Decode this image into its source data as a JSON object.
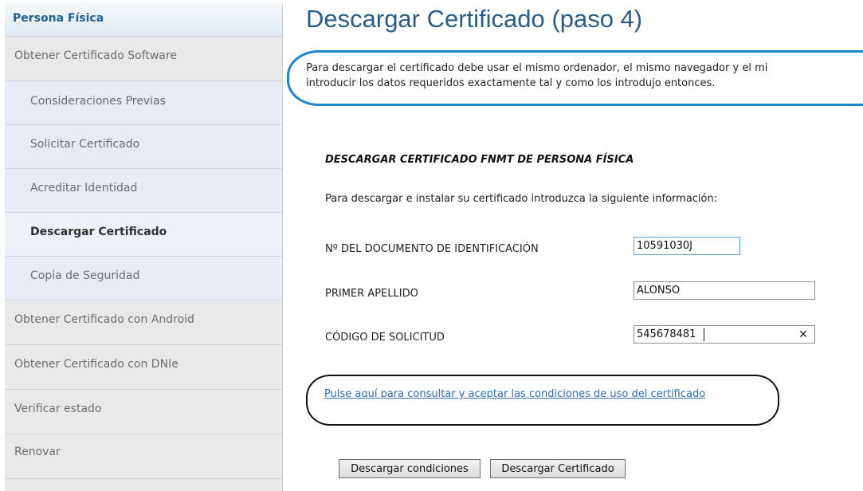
{
  "sidebar": {
    "header": "Persona Física",
    "items": [
      {
        "label": "Obtener Certificado Software"
      },
      {
        "label": "Consideraciones Previas"
      },
      {
        "label": "Solicitar Certificado"
      },
      {
        "label": "Acreditar Identidad"
      },
      {
        "label": "Descargar Certificado"
      },
      {
        "label": "Copia de Seguridad"
      },
      {
        "label": "Obtener Certificado con Android"
      },
      {
        "label": "Obtener Certificado con DNIe"
      },
      {
        "label": "Verificar estado"
      },
      {
        "label": "Renovar"
      }
    ]
  },
  "main": {
    "title": "Descargar Certificado (paso 4)",
    "notice_line1": "Para descargar el certificado debe usar el mismo ordenador, el mismo navegador y el mi",
    "notice_line2": "introducir los datos requeridos exactamente tal y como los introdujo entonces.",
    "section_title": "DESCARGAR CERTIFICADO FNMT DE PERSONA FÍSICA",
    "instructions": "Para descargar e instalar su certificado introduzca la siguiente información:",
    "fields": [
      {
        "label": "Nº DEL DOCUMENTO DE IDENTIFICACIÓN",
        "value": "10591030J"
      },
      {
        "label": "PRIMER APELLIDO",
        "value": "ALONSO"
      },
      {
        "label": "CÓDIGO DE SOLICITUD",
        "value": "545678481"
      }
    ],
    "clear_icon": "close-icon",
    "terms_link": "Pulse aquí para consultar y aceptar las condiciones de uso del certificado",
    "buttons": {
      "download_terms": "Descargar condiciones",
      "download_certificate": "Descargar Certificado"
    }
  },
  "colors": {
    "title": "#2a5c8c",
    "link": "#2b6eb5",
    "notice_highlight": "#1e86cf",
    "link_highlight": "#111111"
  }
}
